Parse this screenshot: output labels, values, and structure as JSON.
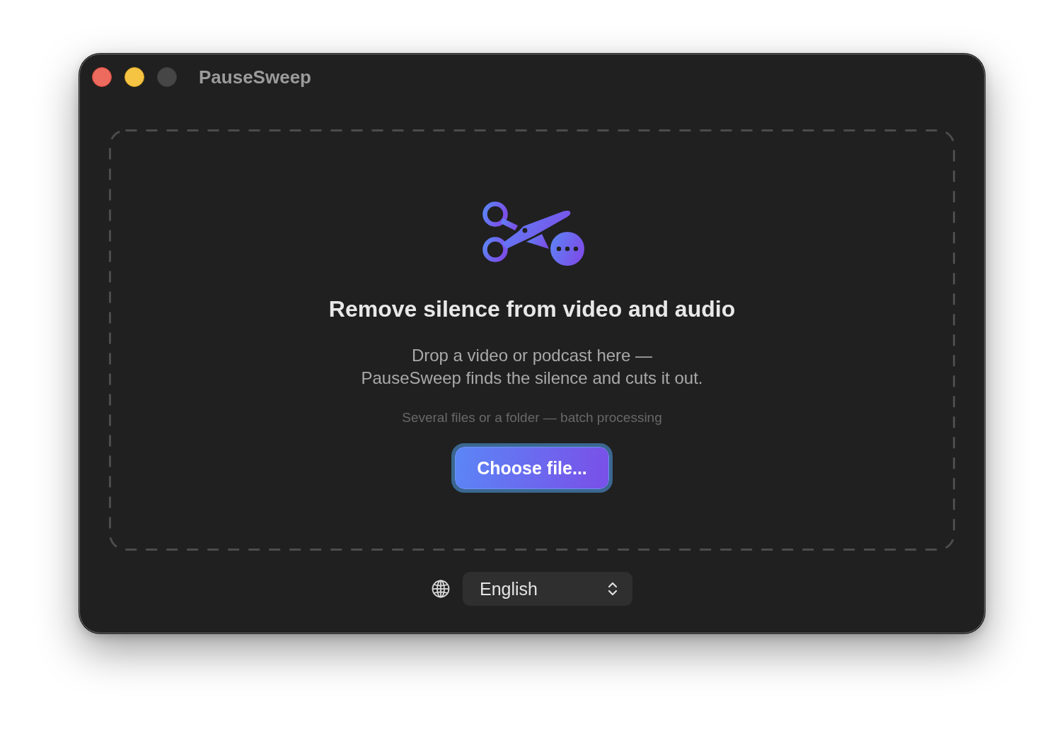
{
  "window": {
    "title": "PauseSweep",
    "controls": [
      {
        "kind": "close",
        "disabled": false
      },
      {
        "kind": "minimize",
        "disabled": false
      },
      {
        "kind": "zoom",
        "disabled": true
      }
    ]
  },
  "drop_zone": {
    "title": "Remove silence from video and audio",
    "description": [
      "Drop a video or podcast here —",
      "PauseSweep finds the silence and cuts it out."
    ],
    "hint": "Several files or a folder — batch processing",
    "button": {
      "label": "Choose file...",
      "focused": true
    }
  },
  "language": {
    "value": "English"
  }
}
